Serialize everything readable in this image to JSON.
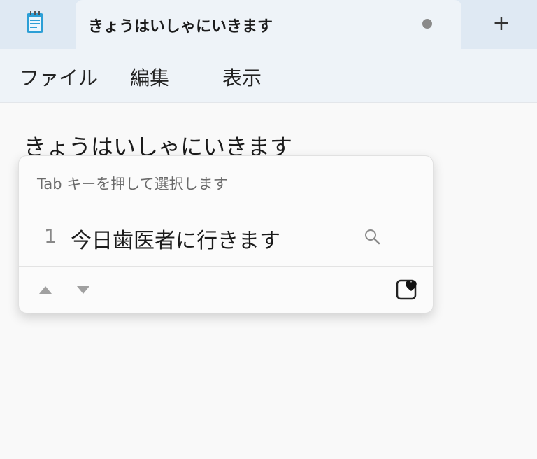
{
  "window": {
    "tab_title": "きょうはいしゃにいきます",
    "new_tab_symbol": "+",
    "app_icon": "notepad-icon",
    "unsaved_indicator": true
  },
  "menu": {
    "file": "ファイル",
    "edit": "編集",
    "view": "表示"
  },
  "editor": {
    "composition_text": "きょうはいしゃにいきます"
  },
  "ime": {
    "hint": "Tab キーを押して選択します",
    "candidates": [
      {
        "number": "1",
        "text": "今日歯医者に行きます"
      }
    ],
    "icons": {
      "search": "search-icon",
      "up": "caret-up-icon",
      "down": "caret-down-icon",
      "emoji": "emoji-heart-icon"
    }
  },
  "colors": {
    "titlebar": "#dfe9f3",
    "tab": "#eef3f8",
    "editor_bg": "#f9f9f9",
    "popup_bg": "#fbfbfb"
  }
}
